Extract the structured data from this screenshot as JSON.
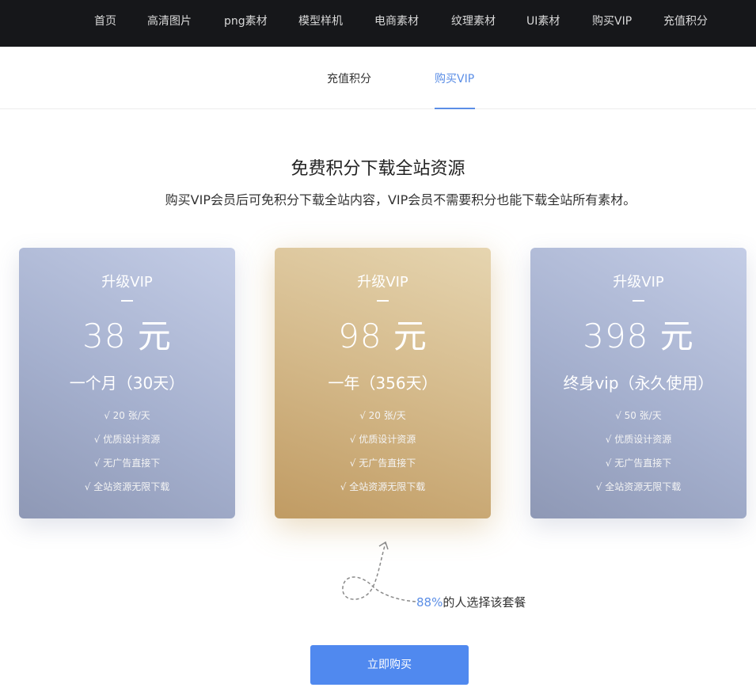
{
  "topnav": {
    "items": [
      "首页",
      "高清图片",
      "png素材",
      "模型样机",
      "电商素材",
      "纹理素材",
      "UI素材",
      "购买VIP",
      "充值积分"
    ]
  },
  "subtabs": {
    "items": [
      "充值积分",
      "购买VIP"
    ],
    "active": "购买VIP"
  },
  "hero": {
    "title": "免费积分下载全站资源",
    "subtitle": "购买VIP会员后可免积分下载全站内容，VIP会员不需要积分也能下载全站所有素材。"
  },
  "plans": [
    {
      "name": "升级VIP",
      "price": "38 元",
      "period": "一个月（30天）",
      "features": [
        "√ 20 张/天",
        "√ 优质设计资源",
        "√ 无广告直接下",
        "√ 全站资源无限下载"
      ],
      "theme": "#a5b0ce"
    },
    {
      "name": "升级VIP",
      "price": "98 元",
      "period": "一年（356天）",
      "features": [
        "√ 20 张/天",
        "√ 优质设计资源",
        "√ 无广告直接下",
        "√ 全站资源无限下载"
      ],
      "theme": "#d4b98a"
    },
    {
      "name": "升级VIP",
      "price": "398 元",
      "period": "终身vip（永久使用）",
      "features": [
        "√ 50 张/天",
        "√ 优质设计资源",
        "√ 无广告直接下",
        "√ 全站资源无限下载"
      ],
      "theme": "#a5b0ce"
    }
  ],
  "note": {
    "percent": "88%",
    "text": "的人选择该套餐"
  },
  "buy_button": {
    "label": "立即购买"
  },
  "colors": {
    "accent": "#5b8ee6",
    "button": "#5089ef",
    "nav_bg": "#16171a"
  }
}
